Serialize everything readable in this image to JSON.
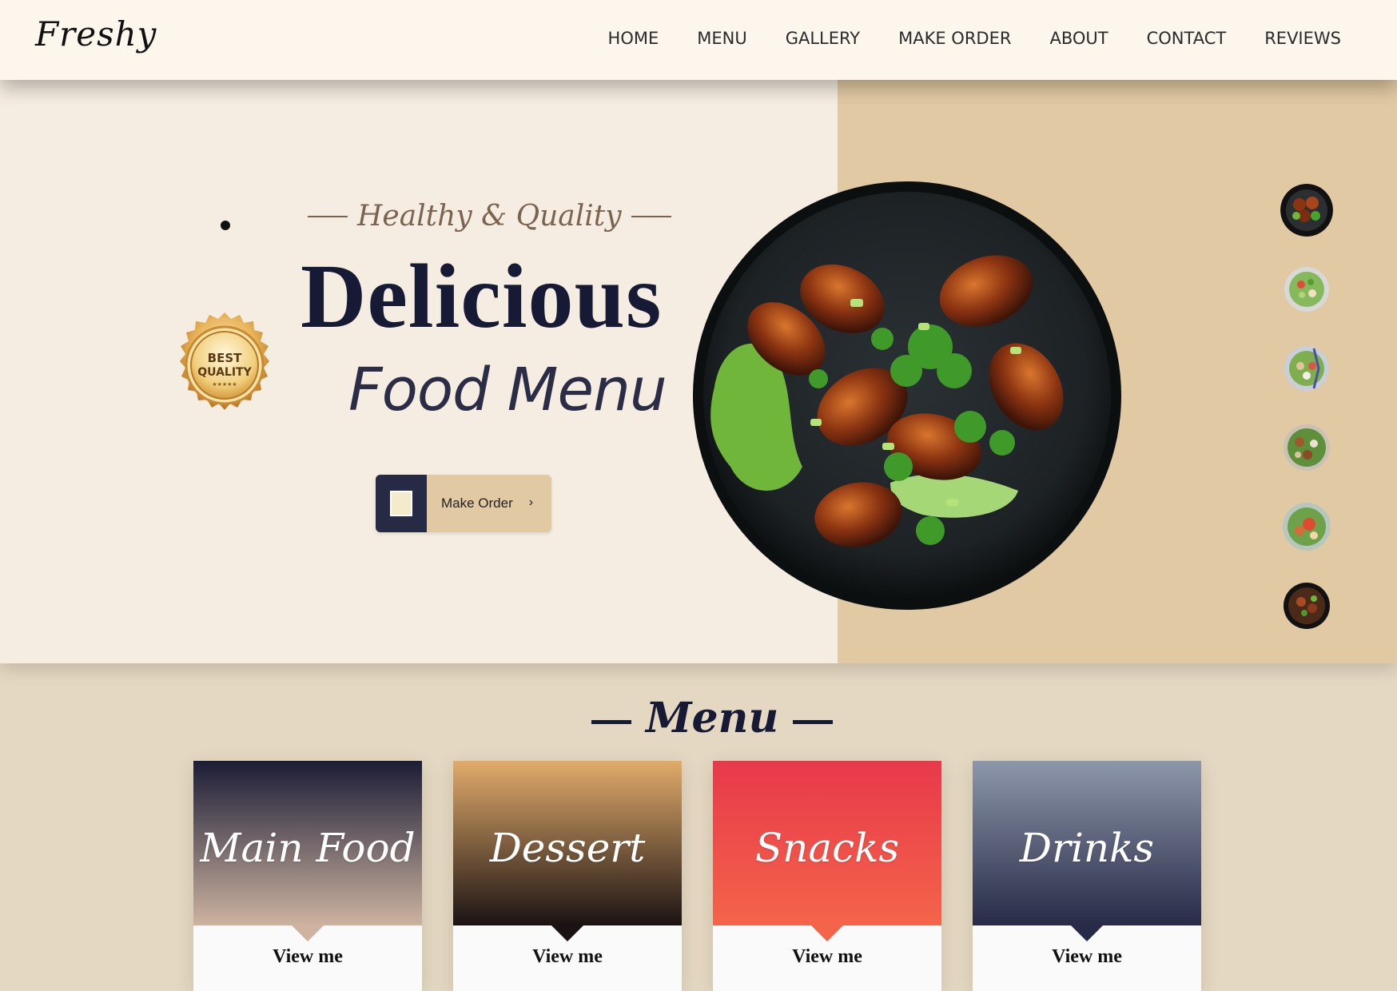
{
  "header": {
    "logo": "Freshy",
    "nav": [
      "HOME",
      "MENU",
      "GALLERY",
      "MAKE ORDER",
      "ABOUT",
      "CONTACT",
      "REVIEWS"
    ]
  },
  "hero": {
    "tagline": "Healthy & Quality",
    "title": "Delicious",
    "subtitle": "Food Menu",
    "badge": {
      "line1": "BEST",
      "line2": "QUALITY"
    },
    "order_button": {
      "label": "Make Order",
      "icon": "chevron-right-icon"
    },
    "thumbnails": [
      "wings-bowl",
      "salad-bowl-1",
      "salad-bowl-2",
      "salad-bowl-3",
      "salad-bowl-4",
      "meat-bowl"
    ]
  },
  "menu": {
    "title": "Menu",
    "cards": [
      {
        "name": "Main Food",
        "button": "View me",
        "colors": [
          "#1b1c36",
          "#cdb3a0"
        ],
        "notch": "#cdb3a0"
      },
      {
        "name": "Dessert",
        "button": "View me",
        "colors": [
          "#e2ab6b",
          "#1b1313"
        ],
        "notch": "#1b1313"
      },
      {
        "name": "Snacks",
        "button": "View me",
        "colors": [
          "#e8394b",
          "#f4644a"
        ],
        "notch": "#f4644a"
      },
      {
        "name": "Drinks",
        "button": "View me",
        "colors": [
          "#8d97aa",
          "#272b47"
        ],
        "notch": "#272b47"
      }
    ]
  },
  "colors": {
    "navy": "#161a35",
    "cream": "#f5ede1",
    "tan": "#e1c9a3",
    "header_bg": "#fdf6ec"
  }
}
